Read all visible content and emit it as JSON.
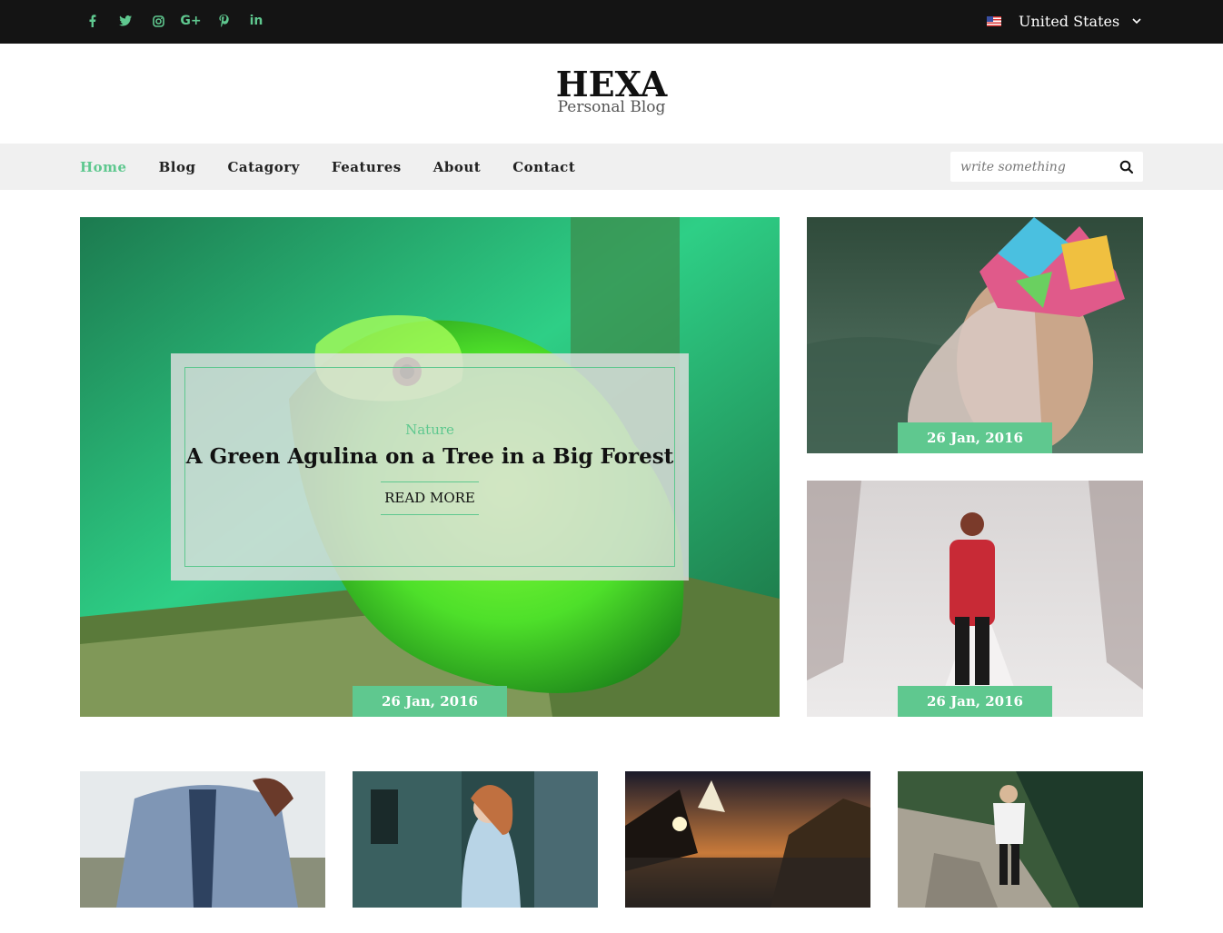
{
  "topbar": {
    "social": [
      {
        "icon": "facebook-icon"
      },
      {
        "icon": "twitter-icon"
      },
      {
        "icon": "instagram-icon"
      },
      {
        "icon": "google-plus-icon",
        "label": "G+"
      },
      {
        "icon": "pinterest-icon"
      },
      {
        "icon": "linkedin-icon",
        "label": "in"
      }
    ],
    "country": "United States",
    "flag_icon": "us-flag-icon"
  },
  "logo": {
    "brand": "HEXA",
    "tagline": "Personal Blog"
  },
  "nav": {
    "items": [
      "Home",
      "Blog",
      "Catagory",
      "Features",
      "About",
      "Contact"
    ],
    "active": "Home",
    "search_placeholder": "write something"
  },
  "featured": {
    "category": "Nature",
    "title": "A Green Agulina on a Tree in a Big Forest",
    "read_more": "READ MORE",
    "date": "26 Jan, 2016"
  },
  "side_posts": [
    {
      "date": "26 Jan, 2016"
    },
    {
      "date": "26 Jan, 2016"
    }
  ],
  "colors": {
    "accent": "#5fc88f",
    "topbar": "#141414",
    "navbar": "#f0f0f0"
  }
}
